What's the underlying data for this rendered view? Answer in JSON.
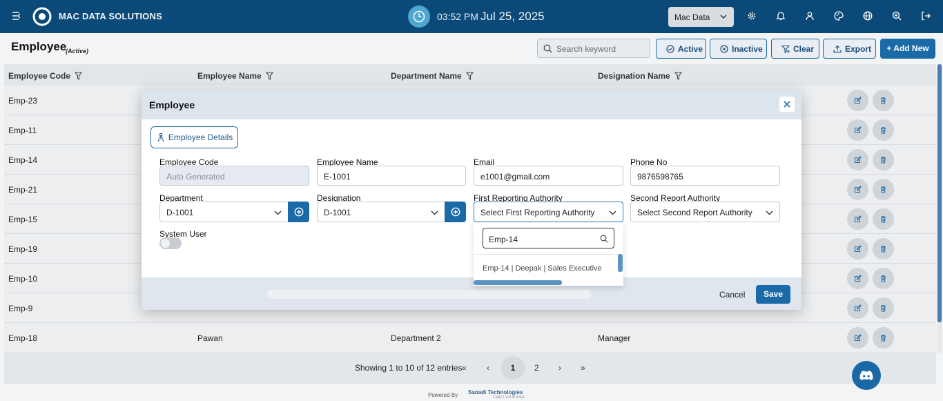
{
  "topbar": {
    "brand": "MAC DATA SOLUTIONS",
    "time": "03:52 PM",
    "date": "Jul 25, 2025",
    "company": "Mac Data",
    "icons": [
      "menu-toggle-icon",
      "gear-icon",
      "bell-icon",
      "user-icon",
      "palette-icon",
      "globe-icon",
      "zoom-icon",
      "logout-icon"
    ]
  },
  "header": {
    "title": "Employee",
    "subtitle": "(Active)",
    "search_placeholder": "Search keyword",
    "active_label": "Active",
    "inactive_label": "Inactive",
    "clear_label": "Clear",
    "export_label": "Export",
    "add_label": "+ Add New"
  },
  "table": {
    "columns": [
      "Employee Code",
      "Employee Name",
      "Department Name",
      "Designation Name"
    ],
    "rows": [
      {
        "code": "Emp-23",
        "name": "",
        "dept": "",
        "desig": ""
      },
      {
        "code": "Emp-11",
        "name": "",
        "dept": "",
        "desig": ""
      },
      {
        "code": "Emp-14",
        "name": "",
        "dept": "",
        "desig": ""
      },
      {
        "code": "Emp-21",
        "name": "",
        "dept": "",
        "desig": ""
      },
      {
        "code": "Emp-15",
        "name": "",
        "dept": "",
        "desig": ""
      },
      {
        "code": "Emp-19",
        "name": "",
        "dept": "",
        "desig": ""
      },
      {
        "code": "Emp-10",
        "name": "",
        "dept": "",
        "desig": ""
      },
      {
        "code": "Emp-9",
        "name": "",
        "dept": "",
        "desig": ""
      },
      {
        "code": "Emp-18",
        "name": "Pawan",
        "dept": "Department 2",
        "desig": "Manager"
      }
    ]
  },
  "pagination": {
    "summary": "Showing 1 to 10 of 12 entries",
    "first": "«",
    "prev": "‹",
    "page1": "1",
    "page2": "2",
    "next": "›",
    "last": "»"
  },
  "footer": {
    "powered_by": "Powered By",
    "company": "Sanadi Technologies",
    "tagline": "CRAFT YOUR IDEA"
  },
  "modal": {
    "title": "Employee",
    "tab_label": "Employee Details",
    "fields": {
      "employee_code": {
        "label": "Employee Code",
        "placeholder": "Auto Generated"
      },
      "employee_name": {
        "label": "Employee Name",
        "value": "E-1001"
      },
      "email": {
        "label": "Email",
        "value": "e1001@gmail.com"
      },
      "phone": {
        "label": "Phone No",
        "value": "9876598765"
      },
      "department": {
        "label": "Department",
        "value": "D-1001"
      },
      "designation": {
        "label": "Designation",
        "value": "D-1001"
      },
      "first_authority": {
        "label": "First Reporting Authority",
        "value": "Select First Reporting Authority"
      },
      "second_authority": {
        "label": "Second Report Authority",
        "value": "Select Second Report Authority"
      },
      "system_user": {
        "label": "System User",
        "checked": false
      }
    },
    "dropdown": {
      "search_value": "Emp-14",
      "options": [
        "Emp-14 | Deepak | Sales Executive"
      ]
    },
    "cancel_label": "Cancel",
    "save_label": "Save"
  },
  "colors": {
    "topbar": "#0b4a78",
    "primary": "#1b6aa8",
    "accent_clock": "#4fa6cf"
  }
}
